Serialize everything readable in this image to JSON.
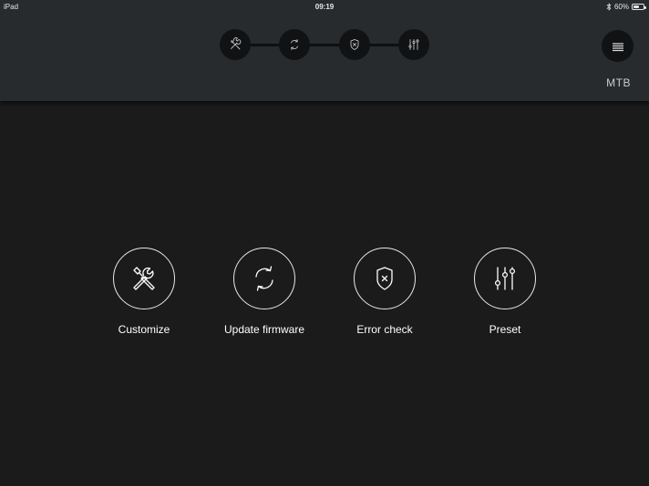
{
  "status_bar": {
    "device": "iPad",
    "time": "09:19",
    "battery_text": "60%",
    "battery_level": 0.6,
    "bluetooth_icon": "bluetooth-icon",
    "battery_icon": "battery-icon"
  },
  "header": {
    "mode_label": "MTB",
    "menu_icon": "menu-icon",
    "steps": [
      {
        "icon": "customize-tools-icon"
      },
      {
        "icon": "update-sync-icon"
      },
      {
        "icon": "error-shield-icon"
      },
      {
        "icon": "preset-sliders-icon"
      }
    ]
  },
  "actions": [
    {
      "label": "Customize",
      "icon": "customize-tools-icon"
    },
    {
      "label": "Update firmware",
      "icon": "update-sync-icon"
    },
    {
      "label": "Error check",
      "icon": "error-shield-icon"
    },
    {
      "label": "Preset",
      "icon": "preset-sliders-icon"
    }
  ],
  "colors": {
    "background": "#1b1b1b",
    "header": "#272b2e",
    "step_circle": "#111213",
    "outline": "#e8e8e8"
  }
}
